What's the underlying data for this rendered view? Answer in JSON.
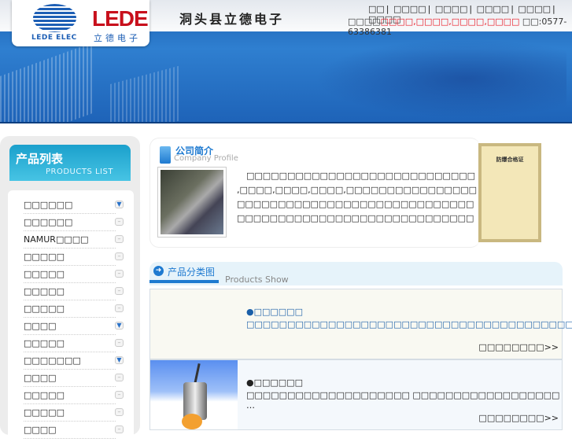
{
  "header": {
    "logo": {
      "en": "LEDE ELEC",
      "brand": "LEDE",
      "cn": "立德电子"
    },
    "site_title": "洞头县立德电子",
    "nav": [
      "□□",
      "□□□□",
      "□□□□",
      "□□□□",
      "□□□□",
      "□□□□"
    ],
    "contact": {
      "label": "□□□□",
      "links": [
        "□□□□",
        "□□□□",
        "□□□□",
        "□□□□"
      ],
      "phone_label": "□□:",
      "phone": "0577-63386381"
    }
  },
  "sidebar": {
    "title_cn": "产品列表",
    "title_en": "PRODUCTS LIST",
    "items": [
      {
        "label": "□□□□□□",
        "icon": "expand-down"
      },
      {
        "label": "□□□□□□",
        "icon": "minus"
      },
      {
        "label": "NAMUR□□□□",
        "icon": "minus"
      },
      {
        "label": "□□□□□",
        "icon": "minus"
      },
      {
        "label": "□□□□□",
        "icon": "minus"
      },
      {
        "label": "□□□□□",
        "icon": "minus"
      },
      {
        "label": "□□□□□",
        "icon": "minus"
      },
      {
        "label": "□□□□",
        "icon": "expand-down"
      },
      {
        "label": "□□□□□",
        "icon": "minus"
      },
      {
        "label": "□□□□□□□",
        "icon": "expand-down"
      },
      {
        "label": "□□□□",
        "icon": "minus"
      },
      {
        "label": "□□□□□",
        "icon": "minus"
      },
      {
        "label": "□□□□□",
        "icon": "minus"
      },
      {
        "label": "□□□□",
        "icon": "minus"
      }
    ]
  },
  "profile": {
    "title_cn": "公司简介",
    "title_en": "Company Profile",
    "intro": "□□□□□□□□□□□□□□□□□□□□□□□□□□□□ ,□□□□,□□□□,□□□□,□□□□□□□□□□□□□□□□□□□□□□□□□□□□□□□□□□□□□□□□□□□□□□□□□□□□□□□□□□□□□□□□□□□□□□□□□□□□□□□□□□□□□□□□□□□□□□□□□□□□□□□□□□□□□□□□□□□□□□□□□□□□□□□□□□□□□□□…",
    "certificate_title": "防爆合格证"
  },
  "products_show": {
    "title_cn": "产品分类图",
    "title_en": "Products Show",
    "items": [
      {
        "name": "●□□□□□□",
        "desc": "□□□□□□□□□□□□□□□□□□□□□□□□□□□□□□□□□□□□□□□□□□…",
        "more": "□□□□□□□□>>"
      },
      {
        "name": "●□□□□□□",
        "desc": "□□□□□□□□□□□□□□□□□□□□ □□□□□□□□□□□□□□□□□□ …",
        "more": "□□□□□□□□>>"
      }
    ]
  }
}
